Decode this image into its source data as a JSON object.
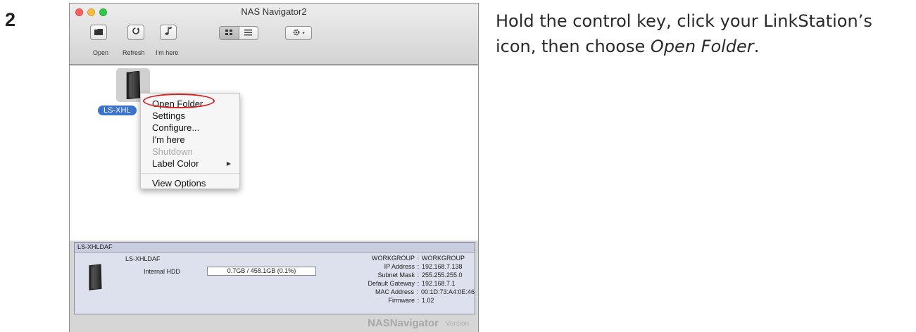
{
  "step": {
    "number": "2"
  },
  "instruction": {
    "text_before": "Hold the control key, click your LinkStation’s icon, then choose ",
    "emphasis": "Open Folder",
    "text_after": "."
  },
  "window": {
    "title": "NAS Navigator2",
    "toolbar": {
      "open_label": "Open",
      "refresh_label": "Refresh",
      "imhere_label": "I'm here"
    }
  },
  "device": {
    "label": "LS-XHL"
  },
  "context_menu": {
    "items": [
      {
        "label": "Open Folder",
        "enabled": true
      },
      {
        "label": "Settings",
        "enabled": true
      },
      {
        "label": "Configure...",
        "enabled": true
      },
      {
        "label": "I'm here",
        "enabled": true
      },
      {
        "label": "Shutdown",
        "enabled": false
      },
      {
        "label": "Label Color",
        "enabled": true,
        "submenu": true
      },
      {
        "label": "View Options",
        "enabled": true
      }
    ]
  },
  "info_panel": {
    "header": "LS-XHLDAF",
    "device_name": "LS-XHLDAF",
    "hdd_label": "Internal HDD",
    "hdd_value": "0.7GB / 458.1GB (0.1%)",
    "rows": [
      {
        "key": "WORKGROUP",
        "value": "WORKGROUP"
      },
      {
        "key": "IP Address",
        "value": "192.168.7.138"
      },
      {
        "key": "Subnet Mask",
        "value": "255.255.255.0"
      },
      {
        "key": "Default Gateway",
        "value": "192.168.7.1"
      },
      {
        "key": "MAC Address",
        "value": "00:1D:73:A4:0E:46"
      },
      {
        "key": "Firmware",
        "value": "1.02"
      }
    ]
  },
  "footer": {
    "brand": "NASNavigator",
    "version": "Version."
  },
  "colors": {
    "highlight_ring": "#d82020",
    "selection": "#3b73cf",
    "panel": "#dde0ed"
  }
}
